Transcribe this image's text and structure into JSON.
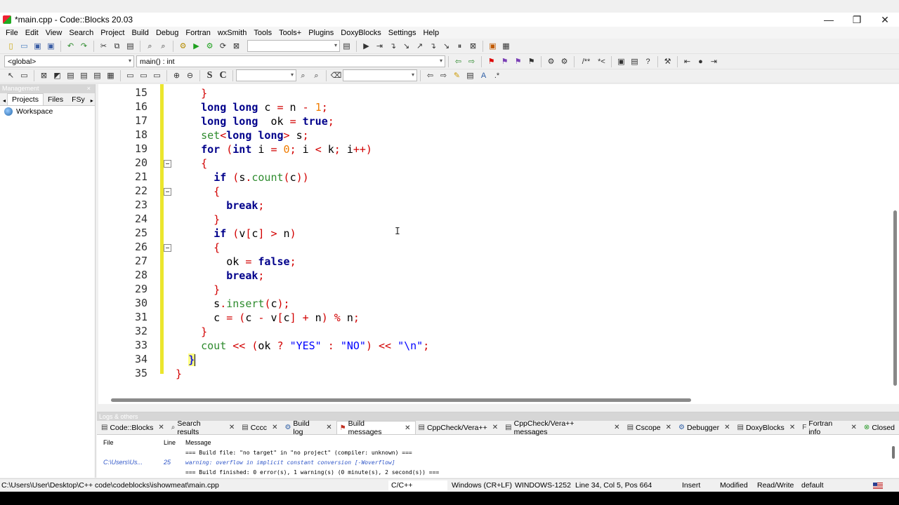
{
  "window": {
    "title": "*main.cpp - Code::Blocks 20.03",
    "buttons": [
      "—",
      "❐",
      "✕"
    ]
  },
  "menu": [
    "File",
    "Edit",
    "View",
    "Search",
    "Project",
    "Build",
    "Debug",
    "Fortran",
    "wxSmith",
    "Tools",
    "Tools+",
    "Plugins",
    "DoxyBlocks",
    "Settings",
    "Help"
  ],
  "scope": {
    "global_value": "<global>",
    "function_value": "main() : int"
  },
  "toolbar_text": {
    "bold_s": "S",
    "bold_c": "C",
    "comment_block": "/**",
    "comment_line": "*<"
  },
  "management": {
    "header": "Management",
    "close": "×",
    "tabs": [
      "Projects",
      "Files",
      "FSy"
    ],
    "tree": [
      "Workspace"
    ]
  },
  "editor": {
    "line_numbers": [
      "15",
      "16",
      "17",
      "18",
      "19",
      "20",
      "21",
      "22",
      "23",
      "24",
      "25",
      "26",
      "27",
      "28",
      "29",
      "30",
      "31",
      "32",
      "33",
      "34",
      "35"
    ],
    "lines": [
      [
        {
          "t": "    }",
          "c": "brace"
        }
      ],
      [
        {
          "t": "    ",
          "c": "id"
        },
        {
          "t": "long long",
          "c": "kw"
        },
        {
          "t": " c ",
          "c": "id"
        },
        {
          "t": "=",
          "c": "op"
        },
        {
          "t": " n ",
          "c": "id"
        },
        {
          "t": "-",
          "c": "op"
        },
        {
          "t": " ",
          "c": "id"
        },
        {
          "t": "1",
          "c": "num"
        },
        {
          "t": ";",
          "c": "op"
        }
      ],
      [
        {
          "t": "    ",
          "c": "id"
        },
        {
          "t": "long long",
          "c": "kw"
        },
        {
          "t": "  ok ",
          "c": "id"
        },
        {
          "t": "=",
          "c": "op"
        },
        {
          "t": " ",
          "c": "id"
        },
        {
          "t": "true",
          "c": "kw"
        },
        {
          "t": ";",
          "c": "op"
        }
      ],
      [
        {
          "t": "    ",
          "c": "id"
        },
        {
          "t": "set",
          "c": "tpl"
        },
        {
          "t": "<",
          "c": "op"
        },
        {
          "t": "long long",
          "c": "kw"
        },
        {
          "t": ">",
          "c": "op"
        },
        {
          "t": " s",
          "c": "id"
        },
        {
          "t": ";",
          "c": "op"
        }
      ],
      [
        {
          "t": "    ",
          "c": "id"
        },
        {
          "t": "for",
          "c": "kw"
        },
        {
          "t": " (",
          "c": "op"
        },
        {
          "t": "int",
          "c": "kw"
        },
        {
          "t": " i ",
          "c": "id"
        },
        {
          "t": "=",
          "c": "op"
        },
        {
          "t": " ",
          "c": "id"
        },
        {
          "t": "0",
          "c": "num"
        },
        {
          "t": ";",
          "c": "op"
        },
        {
          "t": " i ",
          "c": "id"
        },
        {
          "t": "<",
          "c": "op"
        },
        {
          "t": " k",
          "c": "id"
        },
        {
          "t": ";",
          "c": "op"
        },
        {
          "t": " i",
          "c": "id"
        },
        {
          "t": "++)",
          "c": "op"
        }
      ],
      [
        {
          "t": "    {",
          "c": "brace"
        }
      ],
      [
        {
          "t": "      ",
          "c": "id"
        },
        {
          "t": "if",
          "c": "kw"
        },
        {
          "t": " (",
          "c": "op"
        },
        {
          "t": "s",
          "c": "id"
        },
        {
          "t": ".",
          "c": "op"
        },
        {
          "t": "count",
          "c": "fn"
        },
        {
          "t": "(",
          "c": "op"
        },
        {
          "t": "c",
          "c": "id"
        },
        {
          "t": "))",
          "c": "op"
        }
      ],
      [
        {
          "t": "      {",
          "c": "brace"
        }
      ],
      [
        {
          "t": "        ",
          "c": "id"
        },
        {
          "t": "break",
          "c": "kw"
        },
        {
          "t": ";",
          "c": "op"
        }
      ],
      [
        {
          "t": "      }",
          "c": "brace"
        }
      ],
      [
        {
          "t": "      ",
          "c": "id"
        },
        {
          "t": "if",
          "c": "kw"
        },
        {
          "t": " (",
          "c": "op"
        },
        {
          "t": "v",
          "c": "id"
        },
        {
          "t": "[",
          "c": "op"
        },
        {
          "t": "c",
          "c": "id"
        },
        {
          "t": "]",
          "c": "op"
        },
        {
          "t": " ",
          "c": "id"
        },
        {
          "t": ">",
          "c": "op"
        },
        {
          "t": " n",
          "c": "id"
        },
        {
          "t": ")",
          "c": "op"
        }
      ],
      [
        {
          "t": "      {",
          "c": "brace"
        }
      ],
      [
        {
          "t": "        ok ",
          "c": "id"
        },
        {
          "t": "=",
          "c": "op"
        },
        {
          "t": " ",
          "c": "id"
        },
        {
          "t": "false",
          "c": "kw"
        },
        {
          "t": ";",
          "c": "op"
        }
      ],
      [
        {
          "t": "        ",
          "c": "id"
        },
        {
          "t": "break",
          "c": "kw"
        },
        {
          "t": ";",
          "c": "op"
        }
      ],
      [
        {
          "t": "      }",
          "c": "brace"
        }
      ],
      [
        {
          "t": "      s",
          "c": "id"
        },
        {
          "t": ".",
          "c": "op"
        },
        {
          "t": "insert",
          "c": "fn"
        },
        {
          "t": "(",
          "c": "op"
        },
        {
          "t": "c",
          "c": "id"
        },
        {
          "t": ");",
          "c": "op"
        }
      ],
      [
        {
          "t": "      c ",
          "c": "id"
        },
        {
          "t": "=",
          "c": "op"
        },
        {
          "t": " (",
          "c": "op"
        },
        {
          "t": "c ",
          "c": "id"
        },
        {
          "t": "-",
          "c": "op"
        },
        {
          "t": " v",
          "c": "id"
        },
        {
          "t": "[",
          "c": "op"
        },
        {
          "t": "c",
          "c": "id"
        },
        {
          "t": "]",
          "c": "op"
        },
        {
          "t": " ",
          "c": "id"
        },
        {
          "t": "+",
          "c": "op"
        },
        {
          "t": " n",
          "c": "id"
        },
        {
          "t": ")",
          "c": "op"
        },
        {
          "t": " ",
          "c": "id"
        },
        {
          "t": "%",
          "c": "op"
        },
        {
          "t": " n",
          "c": "id"
        },
        {
          "t": ";",
          "c": "op"
        }
      ],
      [
        {
          "t": "    }",
          "c": "brace"
        }
      ],
      [
        {
          "t": "    ",
          "c": "id"
        },
        {
          "t": "cout",
          "c": "fn"
        },
        {
          "t": " << (",
          "c": "op"
        },
        {
          "t": "ok ",
          "c": "id"
        },
        {
          "t": "?",
          "c": "op"
        },
        {
          "t": " ",
          "c": "id"
        },
        {
          "t": "\"YES\"",
          "c": "str"
        },
        {
          "t": " : ",
          "c": "op"
        },
        {
          "t": "\"NO\"",
          "c": "str"
        },
        {
          "t": ") << ",
          "c": "op"
        },
        {
          "t": "\"\\n\"",
          "c": "str"
        },
        {
          "t": ";",
          "c": "op"
        }
      ],
      [
        {
          "t": "  ",
          "c": "id"
        },
        {
          "t": "}",
          "c": "match"
        }
      ],
      [
        {
          "t": "}",
          "c": "brace"
        }
      ]
    ],
    "fold_lines": [
      "20",
      "22",
      "26"
    ],
    "cursor_line": "34"
  },
  "logs": {
    "header": "Logs & others",
    "tabs": [
      {
        "label": "Code::Blocks",
        "icon": "document-icon"
      },
      {
        "label": "Search results",
        "icon": "search-icon"
      },
      {
        "label": "Cccc",
        "icon": "document-icon"
      },
      {
        "label": "Build log",
        "icon": "gear-icon"
      },
      {
        "label": "Build messages",
        "icon": "flag-icon"
      },
      {
        "label": "CppCheck/Vera++",
        "icon": "document-icon"
      },
      {
        "label": "CppCheck/Vera++ messages",
        "icon": "document-icon"
      },
      {
        "label": "Cscope",
        "icon": "document-icon"
      },
      {
        "label": "Debugger",
        "icon": "gear-icon"
      },
      {
        "label": "DoxyBlocks",
        "icon": "document-icon"
      },
      {
        "label": "Fortran info",
        "icon": "fortran-icon"
      },
      {
        "label": "Closed",
        "icon": "close-icon"
      }
    ],
    "active_tab": "Build messages",
    "columns": [
      "File",
      "Line",
      "Message"
    ],
    "rows": [
      {
        "file": "",
        "line": "",
        "message": "=== Build file: \"no target\" in \"no project\" (compiler: unknown) ===",
        "kind": "info"
      },
      {
        "file": "C:\\Users\\Us...",
        "line": "25",
        "message": "warning: overflow in implicit constant conversion [-Woverflow]",
        "kind": "warn"
      },
      {
        "file": "",
        "line": "",
        "message": "=== Build finished: 0 error(s), 1 warning(s) (0 minute(s), 2 second(s)) ===",
        "kind": "info"
      }
    ]
  },
  "status": {
    "path": "C:\\Users\\User\\Desktop\\C++ code\\codeblocks\\ishowmeat\\main.cpp",
    "language": "C/C++",
    "eol": "Windows (CR+LF)",
    "encoding": "WINDOWS-1252",
    "position": "Line 34, Col 5, Pos 664",
    "mode": "Insert",
    "modified": "Modified",
    "access": "Read/Write",
    "profile": "default"
  },
  "colors": {
    "keyword": "#00008b",
    "number": "#f07c00",
    "operator": "#d20000",
    "function": "#2e8b2e",
    "string": "#0000ff",
    "changebar": "#ebe62d"
  }
}
